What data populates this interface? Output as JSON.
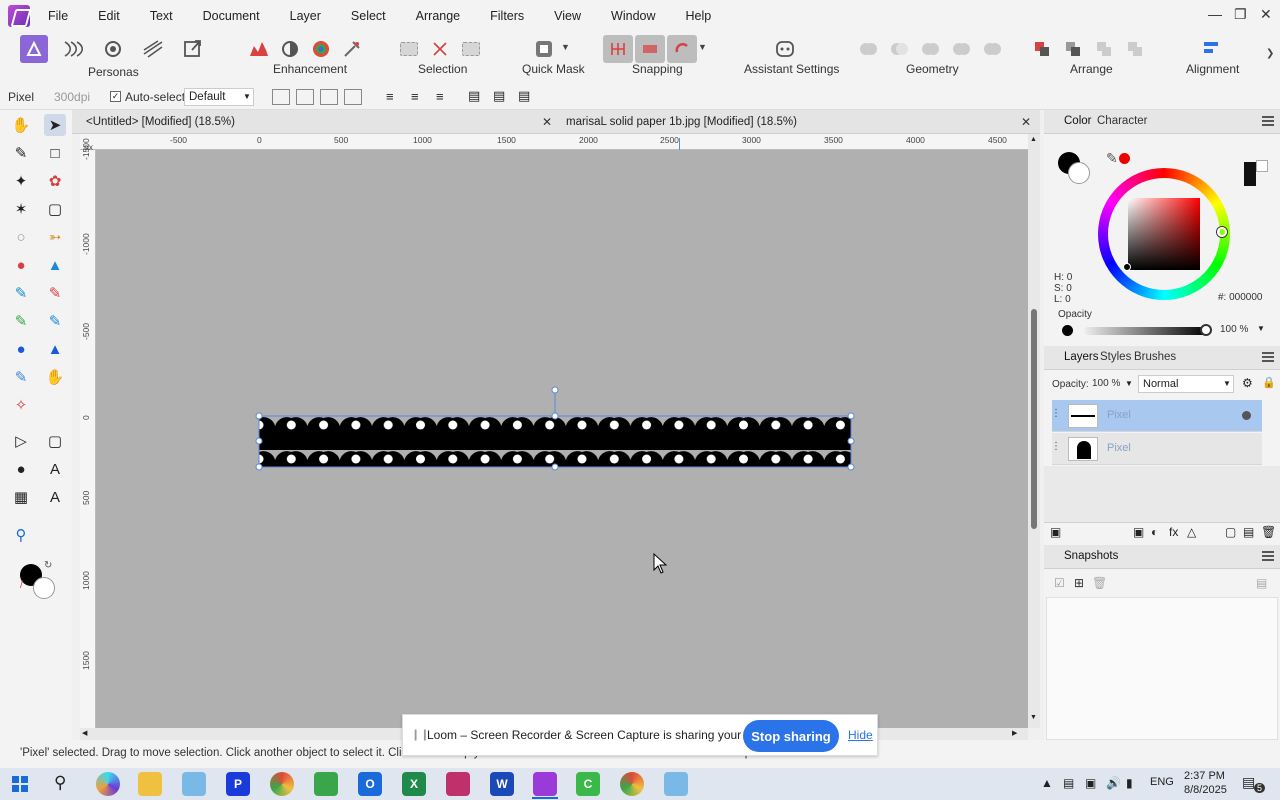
{
  "menu": [
    "File",
    "Edit",
    "Text",
    "Document",
    "Layer",
    "Select",
    "Arrange",
    "Filters",
    "View",
    "Window",
    "Help"
  ],
  "toolbar": {
    "personas": "Personas",
    "enhancement": "Enhancement",
    "selection": "Selection",
    "quick_mask": "Quick Mask",
    "snapping": "Snapping",
    "assistant": "Assistant Settings",
    "geometry": "Geometry",
    "arrange": "Arrange",
    "alignment": "Alignment"
  },
  "context": {
    "persona": "Pixel",
    "dpi": "300dpi",
    "auto_select": "Auto-select:",
    "auto_select_value": "Default"
  },
  "tabs": [
    {
      "label": "<Untitled> [Modified] (18.5%)"
    },
    {
      "label": "marisaL solid paper 1b.jpg [Modified] (18.5%)"
    }
  ],
  "ruler_top": [
    "-500",
    "0",
    "500",
    "1000",
    "1500",
    "2000",
    "2500",
    "3000",
    "3500",
    "4000",
    "4500"
  ],
  "ruler_left": [
    "-1500",
    "-1000",
    "-500",
    "0",
    "500",
    "1000",
    "1500"
  ],
  "ruler_unit": "px",
  "color_panel": {
    "tab_color": "Color",
    "tab_character": "Character",
    "h": "H: 0",
    "s": "S: 0",
    "l": "L: 0",
    "hex": "#: 000000",
    "opacity_label": "Opacity",
    "opacity_value": "100 %"
  },
  "layers_panel": {
    "tab_layers": "Layers",
    "tab_styles": "Styles",
    "tab_brushes": "Brushes",
    "opacity_label": "Opacity:",
    "opacity_value": "100 %",
    "blend_mode": "Normal",
    "layers": [
      {
        "name": "Pixel",
        "selected": true
      },
      {
        "name": "Pixel",
        "selected": false
      }
    ]
  },
  "snapshots_panel": {
    "title": "Snapshots"
  },
  "loom": {
    "text": "Loom – Screen Recorder & Screen Capture is sharing your screen.",
    "stop": "Stop sharing",
    "hide": "Hide"
  },
  "status": {
    "text": "'Pixel' selected. Drag to move selection. Click another object to select it. Click on an empty area to deselect selection. Alt/Ctrl to alter mode. Duplicate values."
  },
  "taskbar": {
    "time": "2:37 PM",
    "date": "8/8/2025",
    "lang": "ENG",
    "notifications": "5"
  },
  "colors": {
    "accent": "#2a73e8",
    "canvas": "#b0b0b0",
    "selected_layer": "#a8c8f0"
  }
}
